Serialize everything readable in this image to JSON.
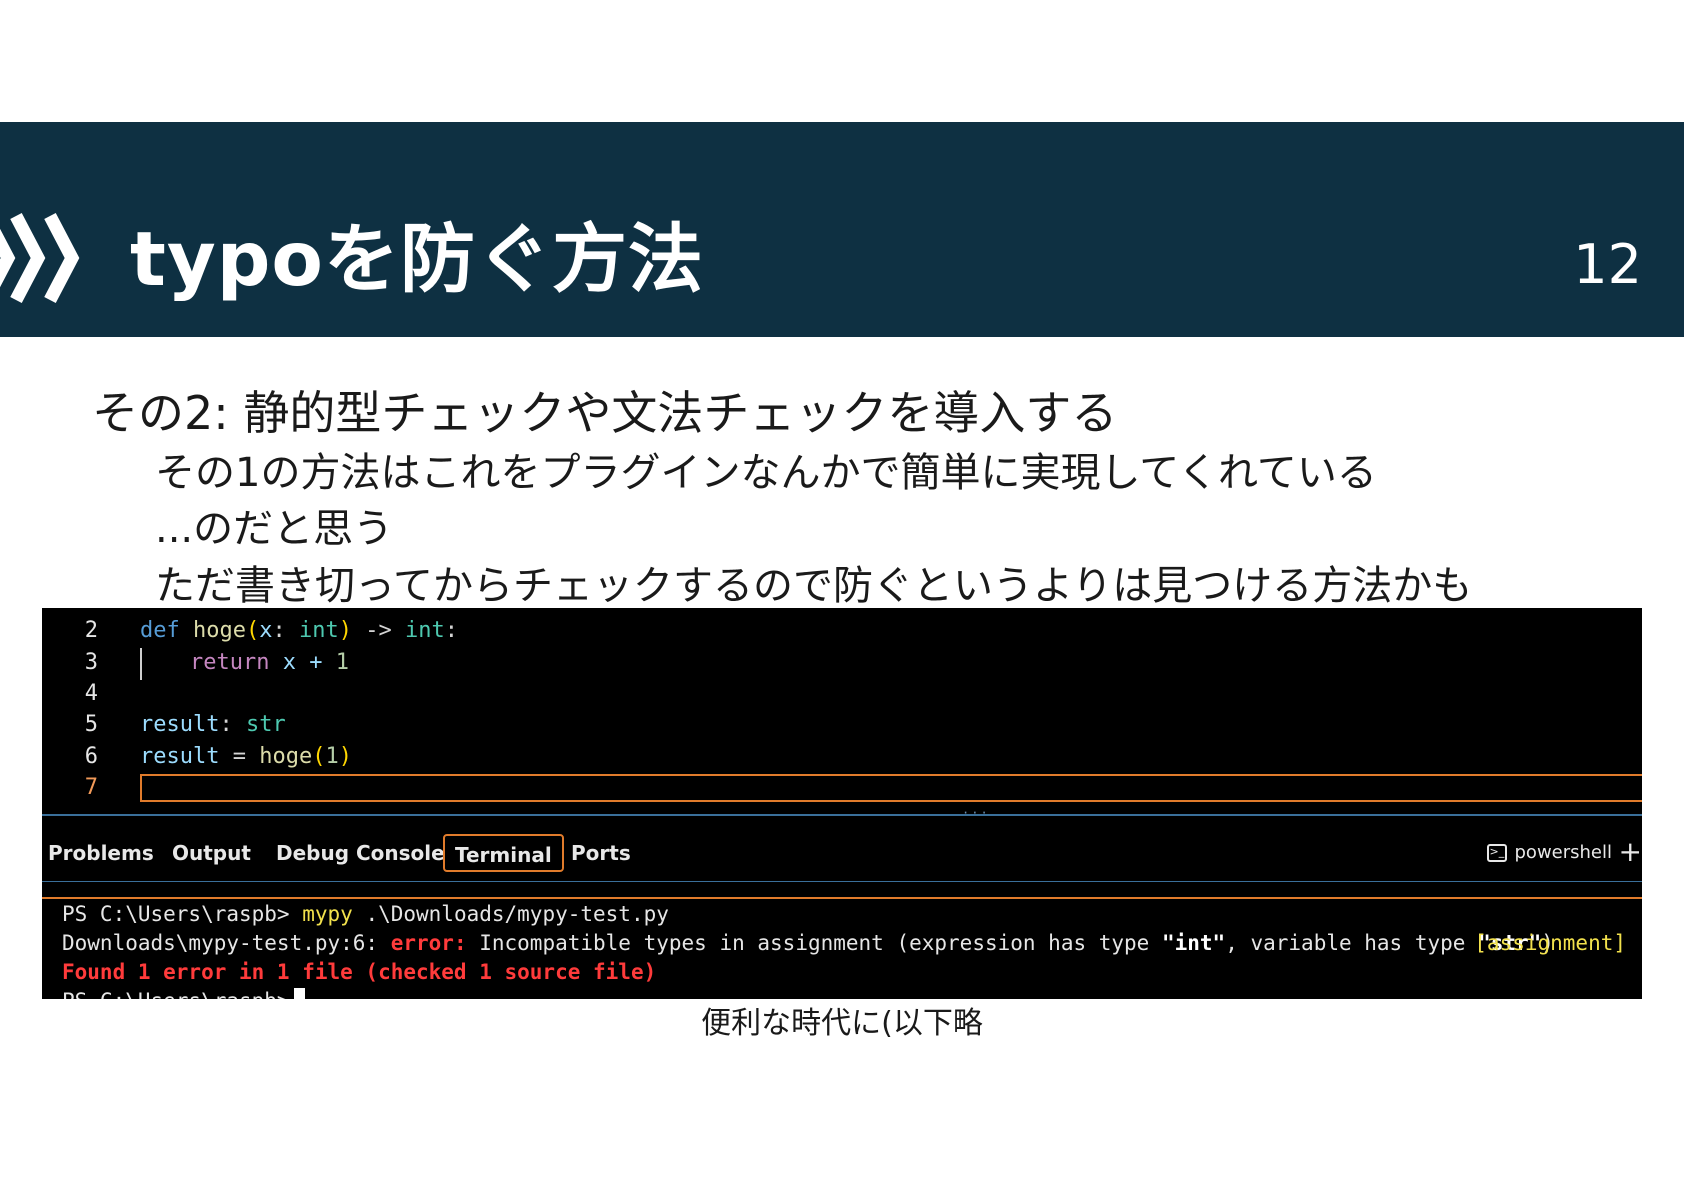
{
  "slide": {
    "title": "typoを防ぐ方法",
    "page_number": "12",
    "subheading": "その2: 静的型チェックや文法チェックを導入する",
    "lines": [
      "その1の方法はこれをプラグインなんかで簡単に実現してくれている",
      "...のだと思う",
      "ただ書き切ってからチェックするので防ぐというよりは見つける方法かも"
    ],
    "caption": "便利な時代に(以下略"
  },
  "editor": {
    "line_numbers": [
      "2",
      "3",
      "4",
      "5",
      "6",
      "7"
    ],
    "code": {
      "l2": {
        "def": "def",
        "name": "hoge",
        "open": "(",
        "param": "x",
        "colon": ": ",
        "ptype": "int",
        "close": ")",
        "arrow": " -> ",
        "rtype": "int",
        "end": ":"
      },
      "l3": {
        "ret": "return",
        "rest": " x + ",
        "num": "1"
      },
      "l5": {
        "var": "result",
        "colon": ": ",
        "type": "str"
      },
      "l6": {
        "var": "result",
        "eq": " = ",
        "call": "hoge",
        "open": "(",
        "arg": "1",
        "close": ")"
      }
    }
  },
  "panel": {
    "tabs": [
      "Problems",
      "Output",
      "Debug Console",
      "Terminal",
      "Ports"
    ],
    "active_tab": "Terminal",
    "shell_label": "powershell",
    "plus_glyph": "+"
  },
  "terminal": {
    "prompt": "PS C:\\Users\\raspb> ",
    "command": "mypy",
    "command_args": " .\\Downloads/mypy-test.py",
    "error_location": "Downloads\\mypy-test.py:6: ",
    "error_label": "error:",
    "error_message_a": " Incompatible types in assignment (expression has type ",
    "error_type_int": "\"int\"",
    "error_message_b": ", variable has type ",
    "error_type_str": "\"str\"",
    "error_message_c": ")",
    "error_tag": "[assignment]",
    "summary": "Found 1 error in 1 file (checked 1 source file)",
    "prompt2": "PS C:\\Users\\raspb>"
  },
  "colors": {
    "header_bg": "#0e3042",
    "accent_orange": "#e07b2b",
    "error_red": "#ff3b3b",
    "command_yellow": "#f2e14c"
  }
}
